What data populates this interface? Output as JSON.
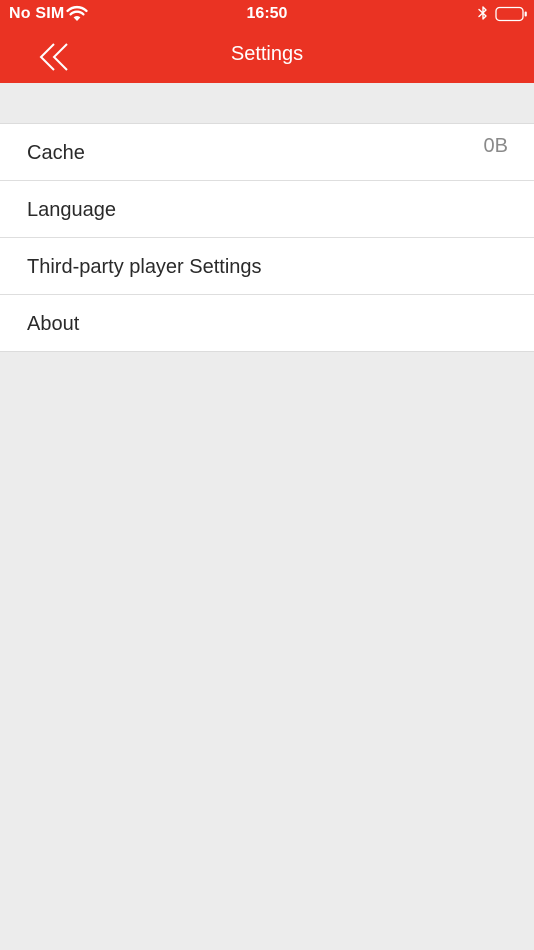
{
  "status_bar": {
    "carrier": "No SIM",
    "time": "16:50",
    "icons": [
      "wifi-icon",
      "bluetooth-icon",
      "battery-icon"
    ]
  },
  "nav": {
    "title": "Settings",
    "back_icon": "double-chevron-left-icon"
  },
  "settings": {
    "items": [
      {
        "label": "Cache",
        "value": "0B"
      },
      {
        "label": "Language"
      },
      {
        "label": "Third-party player Settings"
      },
      {
        "label": "About"
      }
    ]
  },
  "colors": {
    "accent": "#ea3323",
    "background": "#ececec",
    "row_background": "#ffffff",
    "text": "#2a2a2a",
    "secondary_text": "#8a8a8a"
  }
}
